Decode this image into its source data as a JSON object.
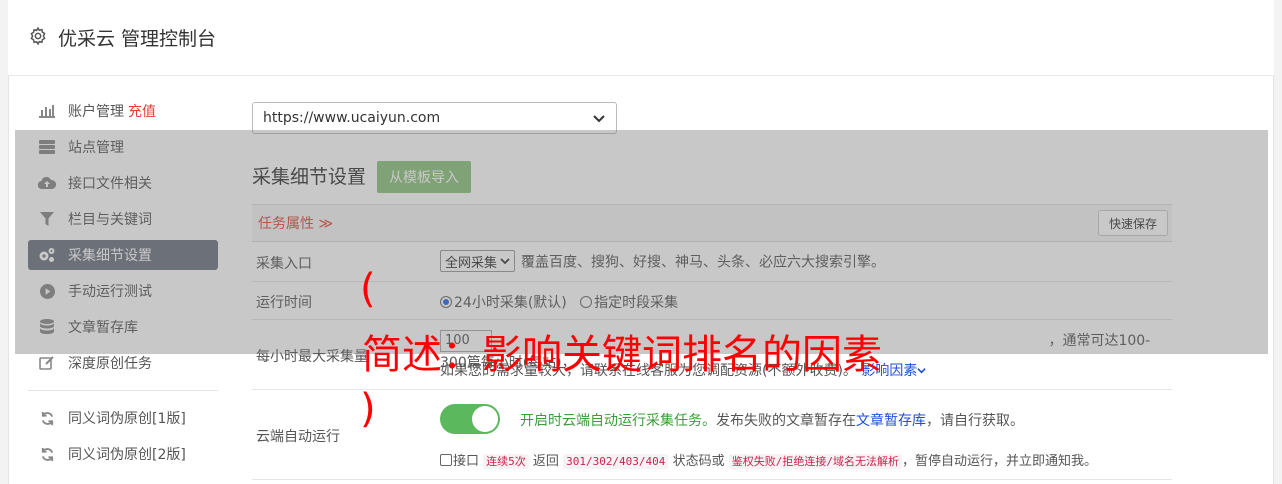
{
  "header": {
    "title": "优采云 管理控制台",
    "icon": "gear-icon"
  },
  "sidebar": {
    "items": [
      {
        "label": "账户管理",
        "extra": "充值",
        "icon": "bar-chart-icon"
      },
      {
        "label": "站点管理",
        "icon": "server-icon"
      },
      {
        "label": "接口文件相关",
        "icon": "cloud-upload-icon"
      },
      {
        "label": "栏目与关键词",
        "icon": "filter-icon"
      },
      {
        "label": "采集细节设置",
        "icon": "cogs-icon",
        "active": true
      },
      {
        "label": "手动运行测试",
        "icon": "play-icon"
      },
      {
        "label": "文章暂存库",
        "icon": "database-icon"
      },
      {
        "label": "深度原创任务",
        "icon": "edit-icon"
      }
    ],
    "items2": [
      {
        "label": "同义词伪原创[1版]",
        "icon": "refresh-icon"
      },
      {
        "label": "同义词伪原创[2版]",
        "icon": "refresh-icon"
      }
    ]
  },
  "site_select": {
    "value": "https://www.ucaiyun.com"
  },
  "section": {
    "title": "采集细节设置",
    "import_btn": "从模板导入"
  },
  "table": {
    "head_title": "任务属性 ≫",
    "save_btn": "快速保存",
    "rows": {
      "entry": {
        "label": "采集入口",
        "select": "全网采集",
        "desc": "覆盖百度、搜狗、好搜、神马、头条、必应六大搜索引擎。"
      },
      "time": {
        "label": "运行时间",
        "opt1": "24小时采集(默认)",
        "opt2": "指定时段采集"
      },
      "max": {
        "label": "每小时最大采集量",
        "input": "100",
        "line1_tail": "，通常可达100-300篇每小时(每站)，",
        "line2": "如果您的需求量较大，请联系在线客服为您调配资源(不额外收费)。",
        "link": "影响因素"
      },
      "cloud": {
        "label": "云端自动运行",
        "on_text": "开启时云端自动运行采集任务。",
        "desc_a": "发布失败的文章暂存在",
        "desc_link": "文章暂存库",
        "desc_b": "，请自行获取。",
        "chk_pre": "接口",
        "code1": "连续5次",
        "mid1": "返回",
        "code2": "301/302/403/404",
        "mid2": "状态码或",
        "code3": "鉴权失败/拒绝连接/域名无法解析",
        "tail": "，暂停自动运行，并立即通知我。"
      }
    }
  },
  "watermark": {
    "open": "(",
    "text": "简述：影响关键词排名的因素",
    "close": ")"
  }
}
